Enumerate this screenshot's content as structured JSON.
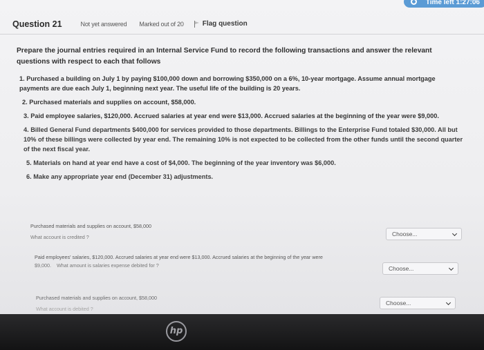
{
  "timer": {
    "text": "Time left 1:27:06"
  },
  "question": {
    "title": "Question 21",
    "status": "Not yet answered",
    "marks": "Marked out of 20",
    "flag_label": "Flag question"
  },
  "intro": "Prepare the journal entries required in an Internal Service Fund to record the following transactions and answer the relevant questions with respect to each that follows",
  "items": [
    "1. Purchased a building on July 1 by paying $100,000 down and borrowing $350,000 on a 6%, 10-year mortgage. Assume annual mortgage payments are due each July 1, beginning next year. The useful life of the building is 20 years.",
    "2. Purchased materials and supplies on account, $58,000.",
    "3. Paid employee salaries, $120,000. Accrued salaries at year end were $13,000. Accrued salaries at the beginning of the year were $9,000.",
    "4. Billed General Fund departments $400,000 for services provided to those departments. Billings to the Enterprise Fund totaled $30,000. All but 10% of these billings were collected by year end. The remaining 10% is not expected to be collected from the other funds until the second quarter of the next fiscal year.",
    "5. Materials on hand at year end have a cost of $4,000. The beginning of the year inventory was $6,000.",
    "6. Make any appropriate year end (December 31) adjustments."
  ],
  "subquestions": [
    {
      "context": "Purchased materials and supplies on account, $58,000",
      "question": "What account is credited ?",
      "select": "Choose..."
    },
    {
      "context": "Paid employees' salaries, $120,000. Accrued salaries at year end were $13,000. Accrued salaries at the beginning of the year were",
      "context2": "$9,000.",
      "question": "What amount is salaries expense debited for ?",
      "select": "Choose..."
    },
    {
      "context": "Purchased materials and supplies on account, $58,000",
      "question": "What account is debited ?",
      "select": "Choose..."
    }
  ],
  "logo": "hp",
  "colors": {
    "timer": "#5b9bd5",
    "bezel": "#1a1a1b"
  }
}
